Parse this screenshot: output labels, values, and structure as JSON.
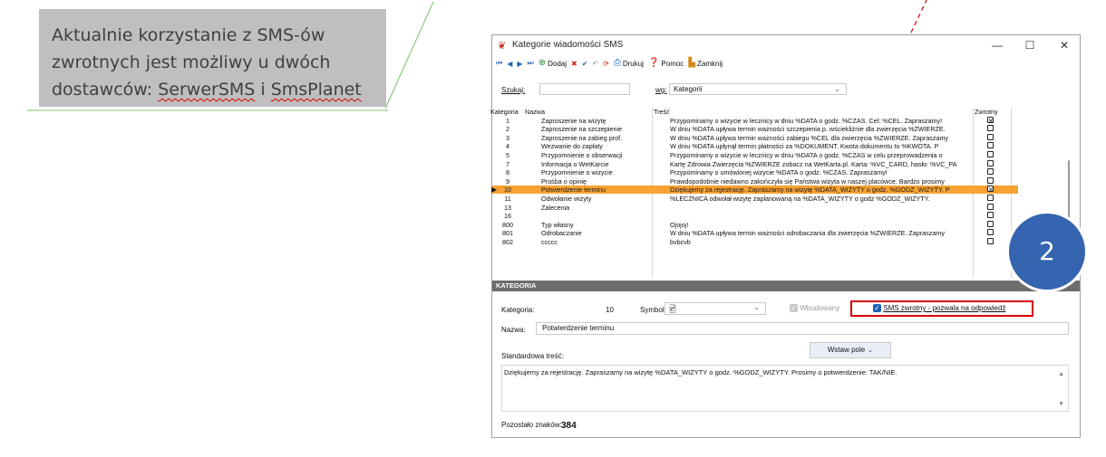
{
  "callout": {
    "line1": "Aktualnie korzystanie z SMS-ów",
    "line2": "zwrotnych jest możliwy u dwóch",
    "line3_prefix": "dostawców: ",
    "provider1": "SerwerSMS",
    "line3_mid": " i ",
    "provider2": "SmsPlanet"
  },
  "badge": "2",
  "window": {
    "title": "Kategorie wiadomości SMS",
    "controls": {
      "minimize": "—",
      "maximize": "☐",
      "close": "✕"
    }
  },
  "toolbar": {
    "first": "⏮",
    "prev": "◀",
    "next": "▶",
    "last": "⏭",
    "add_label": "Dodaj",
    "print_label": "Drukuj",
    "help_label": "Pomoc",
    "close_label": "Zamknij"
  },
  "search": {
    "label": "Szukaj:",
    "value": "",
    "by_label": "wg:",
    "by_value": "Kategorii"
  },
  "grid": {
    "columns": {
      "category": "Kategoria",
      "name": "Nazwa",
      "content": "Treść",
      "reply": "Zwrotny"
    },
    "rows": [
      {
        "cat": "1",
        "name": "Zaproszenie na wizytę",
        "content": "Przypominamy o wizycie w lecznicy w dniu %DATA o godz. %CZAS. Cel: %CEL. Zapraszamy!",
        "reply": true
      },
      {
        "cat": "2",
        "name": "Zaproszenie na szczepienie",
        "content": "W dniu %DATA upływa termin ważności szczepienia p. wściekliźnie dla zwierzęcia %ZWIERZE.",
        "reply": false
      },
      {
        "cat": "3",
        "name": "Zaproszenie na zabieg prof.",
        "content": "W dniu %DATA upływa termin ważności zabiegu %CEL dla zwierzęcia %ZWIERZE. Zapraszamy",
        "reply": false
      },
      {
        "cat": "4",
        "name": "Wezwanie do zapłaty",
        "content": "W dniu %DATA upłynął termin płatności za %DOKUMENT. Kwota dokumentu to %KWOTA. P",
        "reply": false
      },
      {
        "cat": "5",
        "name": "Przypomnienie o obserwacji",
        "content": "Przypominamy o wizycie w lecznicy w dniu %DATA o godz. %CZAS w celu przeprowadzenia o",
        "reply": false
      },
      {
        "cat": "7",
        "name": "Informacja o WetKarcie",
        "content": "Kartę Zdrowia Zwierzęcia %ZWIERZE zobacz na WetKarta.pl. Karta: %VC_CARD, hasło: %VC_PA",
        "reply": false
      },
      {
        "cat": "8",
        "name": "Przypomnienie o wizycie",
        "content": "Przypominamy o umówionej wizycie %DATA o godz. %CZAS. Zapraszamy!",
        "reply": false
      },
      {
        "cat": "9",
        "name": "Prośba o opinię",
        "content": "Prawdopodobnie niedawno zakończyła się Państwa wizyta w naszej placówce. Bardzo prosimy",
        "reply": false
      },
      {
        "cat": "10",
        "name": "Potwierdzenie terminu",
        "content": "Dziękujemy za rejestrację. Zapraszamy na wizytę %DATA_WIZYTY o godz. %GODZ_WIZYTY. P",
        "reply": true
      },
      {
        "cat": "11",
        "name": "Odwołanie wizyty",
        "content": "%LECZNICA odwołał wizytę zaplanowaną na %DATA_WIZYTY o godz %GODZ_WIZYTY.",
        "reply": false
      },
      {
        "cat": "13",
        "name": "Zalecenia",
        "content": "",
        "reply": false
      },
      {
        "cat": "16",
        "name": "",
        "content": "",
        "reply": false
      },
      {
        "cat": "800",
        "name": "Typ własny",
        "content": "Ojojoj!",
        "reply": false
      },
      {
        "cat": "801",
        "name": "Odrobaczanie",
        "content": "W dniu %DATA upływa termin ważności odrobaczania dla zwierzęcia %ZWIERZE. Zapraszamy",
        "reply": false
      },
      {
        "cat": "802",
        "name": "ccccc",
        "content": " bvbcvb",
        "reply": false
      }
    ],
    "selected_index": 8
  },
  "section_title": "KATEGORIA",
  "form": {
    "category_label": "Kategoria:",
    "category_value": "10",
    "symbol_label": "Symbol:",
    "builtin_label": "Wbudowany",
    "reply_label": "SMS zwrotny - pozwala na odpowiedź",
    "name_label": "Nazwa:",
    "name_value": "Potwierdzenie terminu",
    "std_label": "Standardowa treść:",
    "insert_label": "Wstaw pole",
    "std_text": "Dziękujemy za rejestrację. Zapraszamy na wizytę %DATA_WIZYTY o godz. %GODZ_WIZYTY. Prosimy o potwierdzenie: TAK/NIE.",
    "remaining_label": "Pozostało znaków:",
    "remaining_value": "384"
  }
}
